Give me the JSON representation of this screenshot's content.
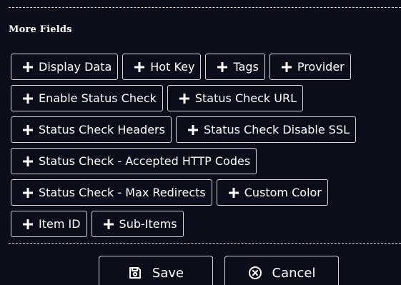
{
  "section": {
    "title": "More Fields"
  },
  "fields": [
    {
      "label": "Display Data",
      "icon": "plus-icon"
    },
    {
      "label": "Hot Key",
      "icon": "plus-icon"
    },
    {
      "label": "Tags",
      "icon": "plus-icon"
    },
    {
      "label": "Provider",
      "icon": "plus-icon"
    },
    {
      "label": "Enable Status Check",
      "icon": "plus-icon"
    },
    {
      "label": "Status Check URL",
      "icon": "plus-icon"
    },
    {
      "label": "Status Check Headers",
      "icon": "plus-icon"
    },
    {
      "label": "Status Check Disable SSL",
      "icon": "plus-icon"
    },
    {
      "label": "Status Check - Accepted HTTP Codes",
      "icon": "plus-icon"
    },
    {
      "label": "Status Check - Max Redirects",
      "icon": "plus-icon"
    },
    {
      "label": "Custom Color",
      "icon": "plus-icon"
    },
    {
      "label": "Item ID",
      "icon": "plus-icon"
    },
    {
      "label": "Sub-Items",
      "icon": "plus-icon"
    }
  ],
  "actions": {
    "save_label": "Save",
    "save_icon": "floppy-disk-icon",
    "cancel_label": "Cancel",
    "cancel_icon": "close-circle-icon"
  },
  "colors": {
    "background": "#0b0d1a",
    "border": "#d9d9d9",
    "text": "#ffffff"
  }
}
